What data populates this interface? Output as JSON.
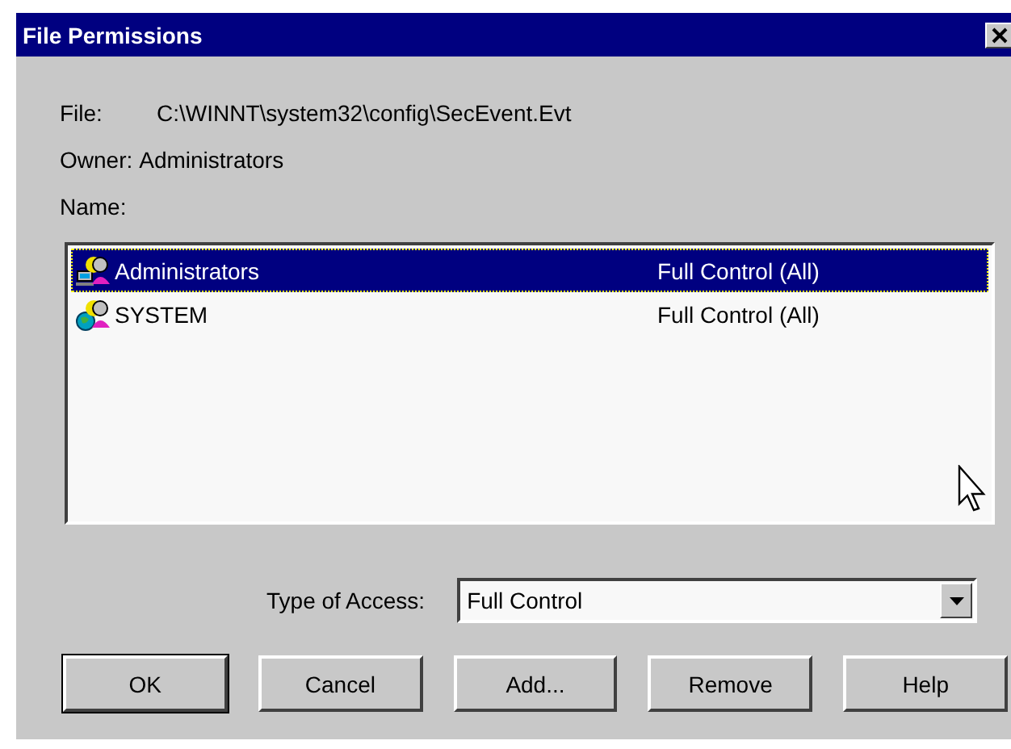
{
  "window": {
    "title": "File Permissions"
  },
  "fields": [
    {
      "label": "File:",
      "value": "C:\\WINNT\\system32\\config\\SecEvent.Evt",
      "kind": "wide"
    },
    {
      "label": "Owner:",
      "value": "Administrators",
      "kind": "tight"
    }
  ],
  "list": {
    "label": "Name:",
    "rows": [
      {
        "name": "Administrators",
        "access": "Full Control (All)",
        "selected": true,
        "kind": "local"
      },
      {
        "name": "SYSTEM",
        "access": "Full Control (All)",
        "selected": false,
        "kind": "global"
      }
    ]
  },
  "type_of_access": {
    "label": "Type of Access:",
    "value": "Full Control"
  },
  "buttons": [
    {
      "label": "OK",
      "kind": "default"
    },
    {
      "label": "Cancel",
      "kind": "normal"
    },
    {
      "label": "Add...",
      "kind": "normal"
    },
    {
      "label": "Remove",
      "kind": "normal"
    },
    {
      "label": "Help",
      "kind": "normal"
    }
  ]
}
